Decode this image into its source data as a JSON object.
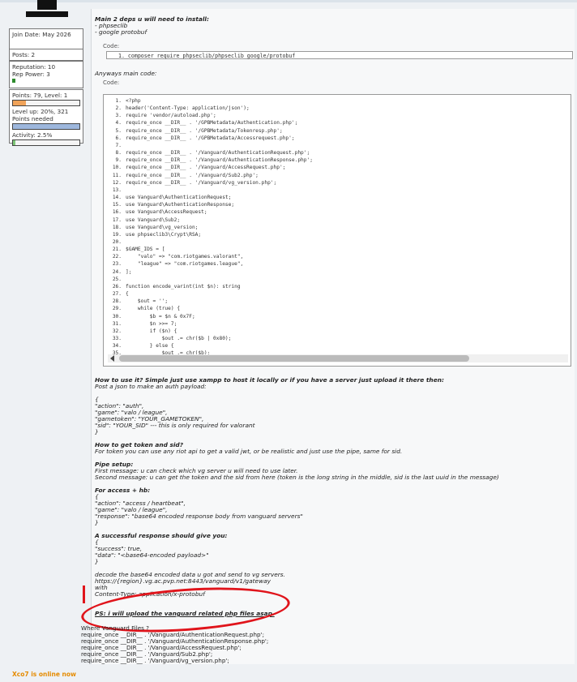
{
  "sidebar": {
    "join_date": "Join Date: May 2026",
    "posts": "Posts: 2",
    "reputation": "Reputation: 10",
    "rep_power": "Rep Power: 3",
    "points": "Points: 79, Level: 1",
    "level_progress": 0.2,
    "levelup": "Level up: 20%, 321 Points needed",
    "activity": "Activity: 2.5%",
    "activity_value": 0.025,
    "online_status": "Xco7 is online now"
  },
  "post": {
    "deps_title": "Main 2 deps u will need to install:",
    "deps": [
      "- phpseclib",
      "- google protobuf"
    ],
    "code_label_1": "Code:",
    "install_cmd": "1.  composer require phpseclib/phpseclib google/protobuf",
    "main_code_title": "Anyways main code:",
    "code_label_2": "Code:",
    "code_lines": [
      {
        "n": "1.",
        "t": "<?php"
      },
      {
        "n": "2.",
        "t": "header('Content-Type: application/json');"
      },
      {
        "n": "3.",
        "t": "require 'vendor/autoload.php';"
      },
      {
        "n": "4.",
        "t": "require_once __DIR__ . '/GPBMetadata/Authentication.php';"
      },
      {
        "n": "5.",
        "t": "require_once __DIR__ . '/GPBMetadata/Tokenresp.php';"
      },
      {
        "n": "6.",
        "t": "require_once __DIR__ . '/GPBMetadata/Accessrequest.php';"
      },
      {
        "n": "7.",
        "t": ""
      },
      {
        "n": "8.",
        "t": "require_once __DIR__ . '/Vanguard/AuthenticationRequest.php';"
      },
      {
        "n": "9.",
        "t": "require_once __DIR__ . '/Vanguard/AuthenticationResponse.php';"
      },
      {
        "n": "10.",
        "t": "require_once __DIR__ . '/Vanguard/AccessRequest.php';"
      },
      {
        "n": "11.",
        "t": "require_once __DIR__ . '/Vanguard/Sub2.php';"
      },
      {
        "n": "12.",
        "t": "require_once __DIR__ . '/Vanguard/vg_version.php';"
      },
      {
        "n": "13.",
        "t": ""
      },
      {
        "n": "14.",
        "t": "use Vanguard\\AuthenticationRequest;"
      },
      {
        "n": "15.",
        "t": "use Vanguard\\AuthenticationResponse;"
      },
      {
        "n": "16.",
        "t": "use Vanguard\\AccessRequest;"
      },
      {
        "n": "17.",
        "t": "use Vanguard\\Sub2;"
      },
      {
        "n": "18.",
        "t": "use Vanguard\\vg_version;"
      },
      {
        "n": "19.",
        "t": "use phpseclib3\\Crypt\\RSA;"
      },
      {
        "n": "20.",
        "t": ""
      },
      {
        "n": "21.",
        "t": "$GAME_IDS = ["
      },
      {
        "n": "22.",
        "t": "    \"valo\" => \"com.riotgames.valorant\","
      },
      {
        "n": "23.",
        "t": "    \"league\" => \"com.riotgames.league\","
      },
      {
        "n": "24.",
        "t": "];"
      },
      {
        "n": "25.",
        "t": ""
      },
      {
        "n": "26.",
        "t": "function encode_varint(int $n): string"
      },
      {
        "n": "27.",
        "t": "{"
      },
      {
        "n": "28.",
        "t": "    $out = '';"
      },
      {
        "n": "29.",
        "t": "    while (true) {"
      },
      {
        "n": "30.",
        "t": "        $b = $n & 0x7F;"
      },
      {
        "n": "31.",
        "t": "        $n >>= 7;"
      },
      {
        "n": "32.",
        "t": "        if ($n) {"
      },
      {
        "n": "33.",
        "t": "            $out .= chr($b | 0x80);"
      },
      {
        "n": "34.",
        "t": "        } else {"
      },
      {
        "n": "35.",
        "t": "            $out .= chr($b);"
      }
    ],
    "howto_title": "How to use it? Simple just use xampp to host it locally or if you have a server just upload it there then:",
    "howto_line": "Post a json to make an auth payload:",
    "auth_json": [
      "{",
      "\"action\": \"auth\",",
      "\"game\": \"valo / league\",",
      "\"gametoken\": \"YOUR_GAMETOKEN\",",
      "\"sid\": \"YOUR_SID\" --- this is only required for valorant",
      "}"
    ],
    "token_title": "How to get token and sid?",
    "token_text": "For token you can use any riot api to get a valid jwt, or be realistic and just use the pipe, same for sid.",
    "pipe_title": "Pipe setup:",
    "pipe_first": "First message: u can check which vg server u will need to use later.",
    "pipe_second": "Second message: u can get the token and the sid from here (token is the long string in the middle, sid is the last uuid in the message)",
    "access_title": "For access + hb:",
    "access_json": [
      "{",
      "\"action\": \"access / heartbeat\",",
      "\"game\": \"valo / league\",",
      "\"response\": \"base64 encoded response body from vanguard servers\"",
      "}"
    ],
    "success_title": "A successful response should give you:",
    "success_json": [
      "{",
      "\"success\": true,",
      "\"data\": \"<base64-encoded payload>\"",
      "}"
    ],
    "decode_lines": [
      "decode the base64 encoded data u got and send to vg servers.",
      "https://{region}.vg.ac.pvp.net:8443/vanguard/v1/gateway",
      "with",
      "Content-Type: application/x-protobuf"
    ],
    "ps": "PS: i will upload the vanguard related php files asap."
  },
  "vanguard_files": [
    "Where Vanguard Files ?",
    "require_once __DIR__ . '/Vanguard/AuthenticationRequest.php';",
    "require_once __DIR__ . '/Vanguard/AuthenticationResponse.php';",
    "require_once __DIR__ . '/Vanguard/AccessRequest.php';",
    "require_once __DIR__ . '/Vanguard/Sub2.php';",
    "require_once __DIR__ . '/Vanguard/vg_version.php';"
  ],
  "colors": {
    "accent": "#e58b00",
    "annotation": "#e0141b",
    "activity_fill": "#7cc576",
    "level_fill": "#f0a35a"
  }
}
